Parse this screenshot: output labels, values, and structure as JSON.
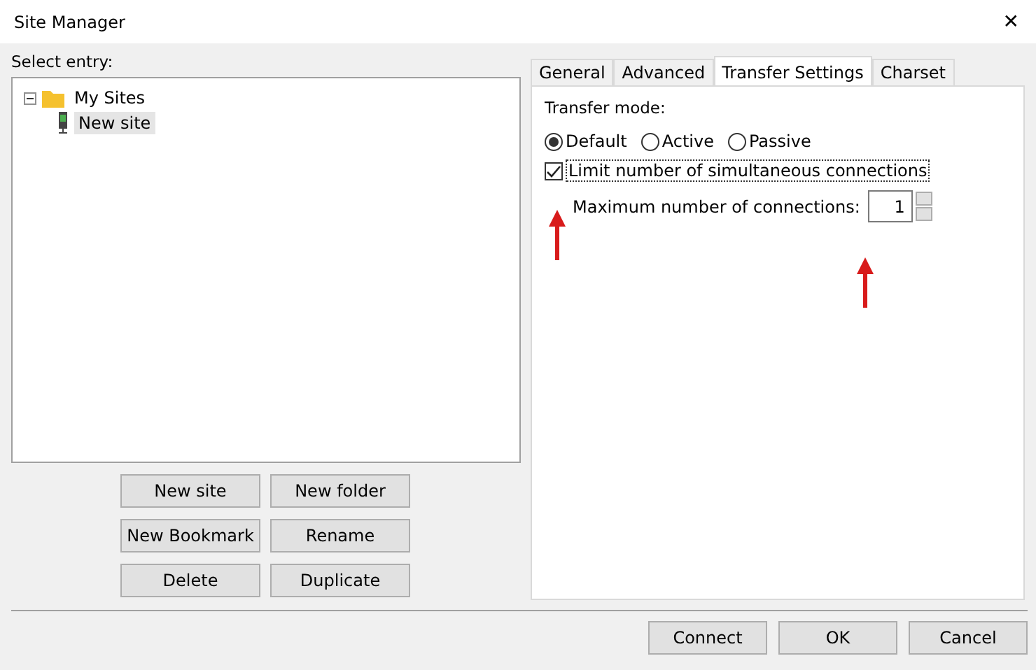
{
  "window": {
    "title": "Site Manager",
    "close": "✕"
  },
  "select_label": "Select entry:",
  "tree": [
    {
      "label": "My Sites",
      "kind": "folder",
      "expanded": true,
      "selected": false,
      "children": [
        {
          "label": "New site",
          "kind": "site",
          "selected": true
        }
      ]
    }
  ],
  "tree_buttons": [
    "New site",
    "New folder",
    "New Bookmark",
    "Rename",
    "Delete",
    "Duplicate"
  ],
  "tabs": [
    {
      "label": "General",
      "selected": false
    },
    {
      "label": "Advanced",
      "selected": false
    },
    {
      "label": "Transfer Settings",
      "selected": true
    },
    {
      "label": "Charset",
      "selected": false
    }
  ],
  "transfer_mode": {
    "label": "Transfer mode:",
    "options": [
      {
        "label": "Default",
        "selected": true
      },
      {
        "label": "Active",
        "selected": false
      },
      {
        "label": "Passive",
        "selected": false
      }
    ]
  },
  "limit_connections": {
    "label": "Limit number of simultaneous connections",
    "checked": true
  },
  "max_connections": {
    "label": "Maximum number of connections:",
    "value": "1"
  },
  "buttons": [
    "Connect",
    "OK",
    "Cancel"
  ]
}
